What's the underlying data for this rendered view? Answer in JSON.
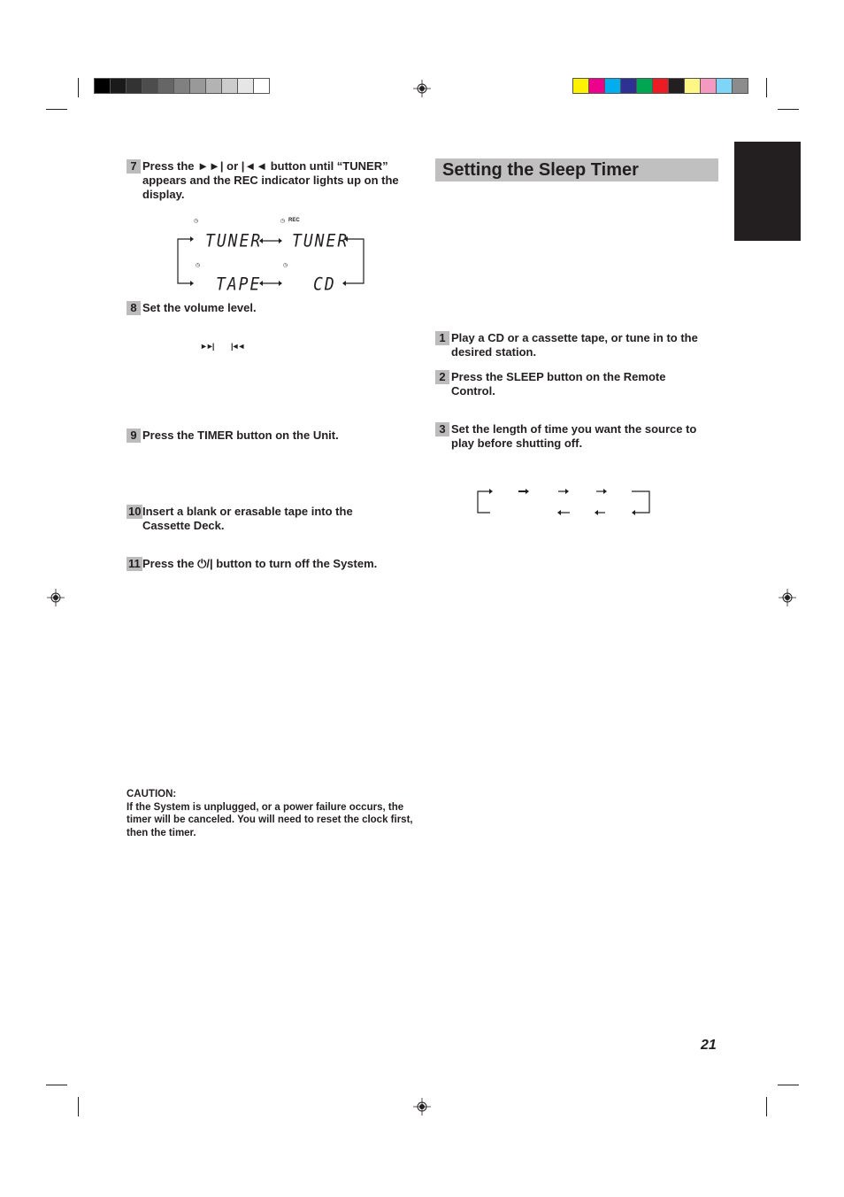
{
  "color_bars": {
    "grayscale": [
      "#000000",
      "#1a1a1a",
      "#333333",
      "#4d4d4d",
      "#666666",
      "#808080",
      "#999999",
      "#b3b3b3",
      "#cccccc",
      "#e6e6e6",
      "#ffffff"
    ],
    "colors": [
      "#fff200",
      "#ec008c",
      "#00aeef",
      "#2e3192",
      "#00a651",
      "#ed1c24",
      "#231f20",
      "#fff685",
      "#f49ac1",
      "#7fd5f7",
      "#8c8c8c"
    ]
  },
  "left_column": {
    "steps": [
      {
        "number": "7",
        "text": "Press the ►►| or |◄◄ button until “TUNER” appears and the REC indicator lights up on the display."
      },
      {
        "number": "8",
        "text": "Set the volume level."
      },
      {
        "number": "9",
        "text": "Press the TIMER button on the Unit."
      },
      {
        "number": "10",
        "text": "Insert a blank or erasable tape into the Cassette Deck."
      },
      {
        "number": "11",
        "text": "Press the  ⏻/| button to turn off the System."
      }
    ],
    "display_diagram": {
      "items": [
        "TUNER",
        "TUNER",
        "TAPE",
        "CD"
      ],
      "rec_indicator": "REC",
      "timer_icon": "◷"
    },
    "skip_icons": {
      "forward": "►►|",
      "backward": "|◄◄"
    },
    "caution": {
      "heading": "CAUTION:",
      "text": "If the System is unplugged, or a power failure occurs, the timer will be canceled. You will need to reset the clock first, then the timer."
    }
  },
  "right_column": {
    "section_title": "Setting the Sleep Timer",
    "steps": [
      {
        "number": "1",
        "text": "Play a CD or a cassette tape, or tune in to the desired station."
      },
      {
        "number": "2",
        "text": "Press the SLEEP button on the Remote Control."
      },
      {
        "number": "3",
        "text": "Set the length of time you want the source to play before shutting off."
      }
    ]
  },
  "page_number": "21"
}
